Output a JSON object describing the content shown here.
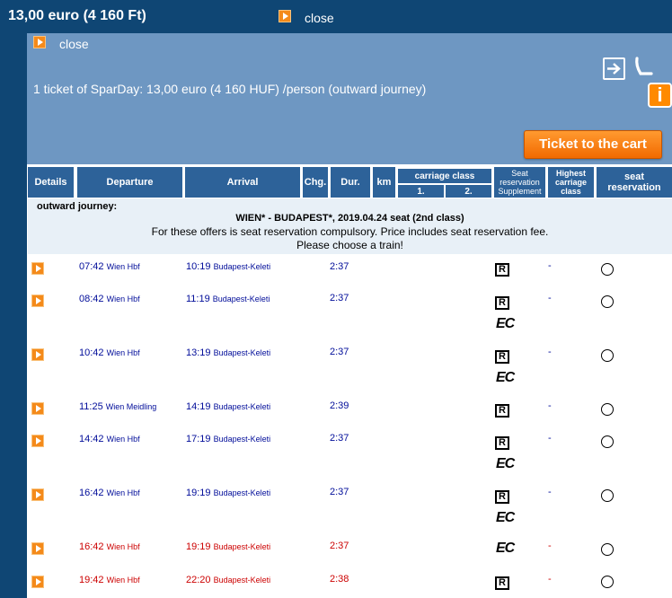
{
  "top_bar": {
    "price_text": "13,00 euro (4 160 Ft)",
    "close_label": "close"
  },
  "panel": {
    "close_label": "close",
    "summary": "1 ticket of SparDay: 13,00 euro (4 160 HUF) /person (outward journey)",
    "info_icon": "i",
    "cart_button": "Ticket to the cart",
    "icons": [
      "arrow-right-icon",
      "seat-icon",
      "info-icon"
    ]
  },
  "table_header": {
    "details": "Details",
    "departure": "Departure",
    "arrival": "Arrival",
    "changes": "Chg.",
    "duration": "Dur.",
    "km": "km",
    "carriage_class": "carriage class",
    "class_1": "1.",
    "class_2": "2.",
    "seat_res_supplement": "Seat reservation Supplement",
    "highest_class": "Highest carriage class",
    "seat_reservation": "seat reservation"
  },
  "info": {
    "outward": "outward journey:",
    "route": "WIEN* - BUDAPEST*, 2019.04.24 seat (2nd class)",
    "line1": "For these offers is seat reservation compulsory. Price includes seat reservation fee.",
    "line2": "Please choose a train!"
  },
  "badges": {
    "reservation": "R",
    "train_type": "EC"
  },
  "rows": [
    {
      "dep_time": "07:42",
      "dep_station": "Wien Hbf",
      "arr_time": "10:19",
      "arr_station": "Budapest-Keleti",
      "duration": "2:37",
      "highest": "-"
    },
    {
      "dep_time": "08:42",
      "dep_station": "Wien Hbf",
      "arr_time": "11:19",
      "arr_station": "Budapest-Keleti",
      "duration": "2:37",
      "highest": "-"
    },
    {
      "dep_time": "10:42",
      "dep_station": "Wien Hbf",
      "arr_time": "13:19",
      "arr_station": "Budapest-Keleti",
      "duration": "2:37",
      "highest": "-"
    },
    {
      "dep_time": "11:25",
      "dep_station": "Wien Meidling",
      "arr_time": "14:19",
      "arr_station": "Budapest-Keleti",
      "duration": "2:39",
      "highest": "-"
    },
    {
      "dep_time": "14:42",
      "dep_station": "Wien Hbf",
      "arr_time": "17:19",
      "arr_station": "Budapest-Keleti",
      "duration": "2:37",
      "highest": "-"
    },
    {
      "dep_time": "16:42",
      "dep_station": "Wien Hbf",
      "arr_time": "19:19",
      "arr_station": "Budapest-Keleti",
      "duration": "2:37",
      "highest": "-"
    },
    {
      "dep_time": "16:42",
      "dep_station": "Wien Hbf",
      "arr_time": "19:19",
      "arr_station": "Budapest-Keleti",
      "duration": "2:37",
      "highest": "-"
    },
    {
      "dep_time": "19:42",
      "dep_station": "Wien Hbf",
      "arr_time": "22:20",
      "arr_station": "Budapest-Keleti",
      "duration": "2:38",
      "highest": "-"
    }
  ]
}
